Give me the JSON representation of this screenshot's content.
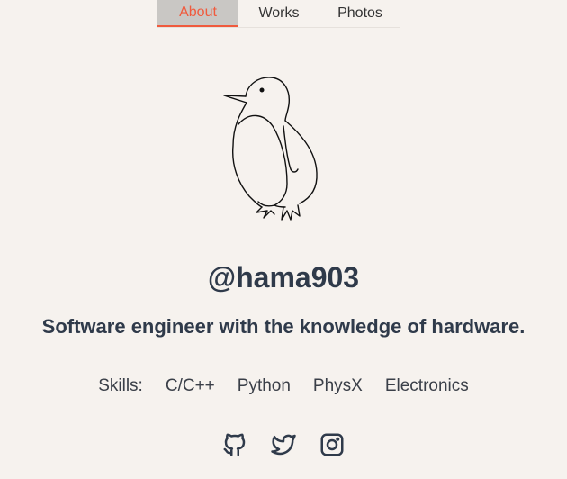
{
  "nav": {
    "tabs": [
      {
        "label": "About",
        "active": true
      },
      {
        "label": "Works",
        "active": false
      },
      {
        "label": "Photos",
        "active": false
      }
    ]
  },
  "profile": {
    "avatar_icon": "penguin-drawing",
    "handle": "@hama903",
    "tagline": "Software engineer with the knowledge of hardware."
  },
  "skills": {
    "label": "Skills:",
    "items": [
      "C/C++",
      "Python",
      "PhysX",
      "Electronics"
    ]
  },
  "social": [
    {
      "icon": "github-icon"
    },
    {
      "icon": "twitter-icon"
    },
    {
      "icon": "instagram-icon"
    }
  ],
  "colors": {
    "background": "#f6f2ee",
    "accent": "#f05a3d",
    "text": "#2f3a4a",
    "active_tab_bg": "#c9c7c4"
  }
}
